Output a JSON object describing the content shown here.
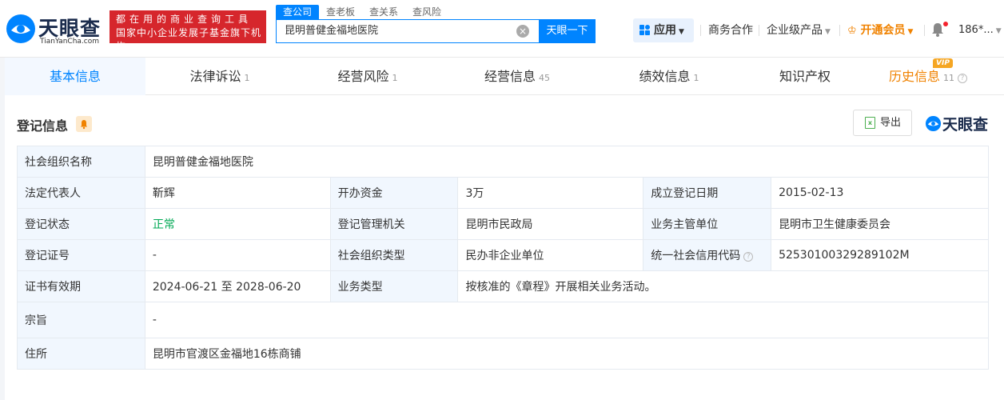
{
  "logo": {
    "name_cn": "天眼查",
    "name_en": "TianYanCha.com"
  },
  "slogan": {
    "line1": "都在用的商业查询工具",
    "line2": "国家中小企业发展子基金旗下机构"
  },
  "search": {
    "tabs": [
      "查公司",
      "查老板",
      "查关系",
      "查风险"
    ],
    "value": "昆明普健金福地医院",
    "button": "天眼一下"
  },
  "nav": {
    "app": "应用",
    "cooperation": "商务合作",
    "enterprise": "企业级产品",
    "vip": "开通会员",
    "user": "186*..."
  },
  "tabs": [
    {
      "label": "基本信息",
      "count": ""
    },
    {
      "label": "法律诉讼",
      "count": "1"
    },
    {
      "label": "经营风险",
      "count": "1"
    },
    {
      "label": "经营信息",
      "count": "45"
    },
    {
      "label": "绩效信息",
      "count": "1"
    },
    {
      "label": "知识产权",
      "count": ""
    },
    {
      "label": "历史信息",
      "count": "11",
      "badge": "VIP"
    }
  ],
  "section": {
    "title": "登记信息",
    "export": "导出",
    "brand": "天眼查"
  },
  "info": {
    "org_name_label": "社会组织名称",
    "org_name": "昆明普健金福地医院",
    "legal_rep_label": "法定代表人",
    "legal_rep": "靳辉",
    "capital_label": "开办资金",
    "capital": "3万",
    "reg_date_label": "成立登记日期",
    "reg_date": "2015-02-13",
    "status_label": "登记状态",
    "status": "正常",
    "authority_label": "登记管理机关",
    "authority": "昆明市民政局",
    "supervisor_label": "业务主管单位",
    "supervisor": "昆明市卫生健康委员会",
    "cert_no_label": "登记证号",
    "cert_no": "-",
    "org_type_label": "社会组织类型",
    "org_type": "民办非企业单位",
    "credit_code_label": "统一社会信用代码",
    "credit_code": "52530100329289102M",
    "validity_label": "证书有效期",
    "validity": "2024-06-21 至 2028-06-20",
    "biz_type_label": "业务类型",
    "biz_type": "按核准的《章程》开展相关业务活动。",
    "purpose_label": "宗旨",
    "purpose": "-",
    "address_label": "住所",
    "address": "昆明市官渡区金福地16栋商铺"
  },
  "colors": {
    "accent": "#0084ff",
    "brand_red": "#d6262c",
    "vip": "#f08200",
    "status_ok": "#00a854"
  }
}
